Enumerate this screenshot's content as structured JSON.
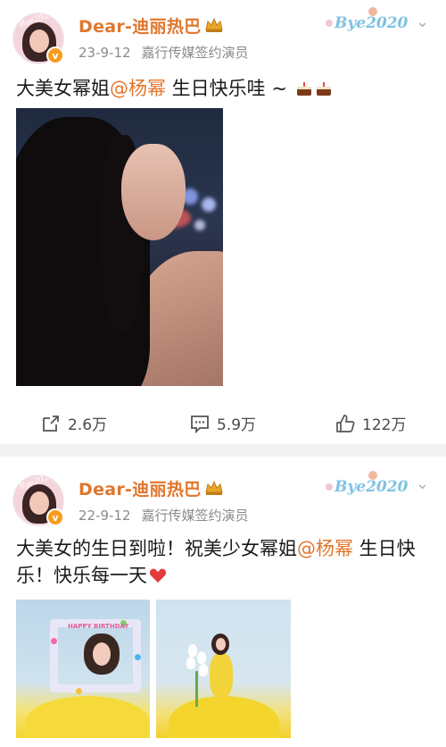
{
  "posts": [
    {
      "username": "Dear-迪丽热巴",
      "date": "23-9-12",
      "source": "嘉行传媒签约演员",
      "badge_decoration": "Bye2020",
      "text_before": "大美女幂姐",
      "mention": "@杨幂",
      "text_after": " 生日快乐哇 ~",
      "emoji": [
        "cake-emoji",
        "cake-emoji"
      ],
      "actions": {
        "repost": "2.6万",
        "comment": "5.9万",
        "like": "122万"
      }
    },
    {
      "username": "Dear-迪丽热巴",
      "date": "22-9-12",
      "source": "嘉行传媒签约演员",
      "badge_decoration": "Bye2020",
      "text_before": "大美女的生日到啦！祝美少女幂姐",
      "mention": "@杨幂",
      "text_after": " 生日快乐！快乐每一天",
      "emoji": [
        "heart-emoji"
      ],
      "frame_text": "HAPPY BIRTHDAY"
    }
  ],
  "colors": {
    "accent": "#e0762c",
    "meta": "#8a8a8a",
    "separator": "#f2f2f2",
    "heart": "#e33b3b"
  }
}
